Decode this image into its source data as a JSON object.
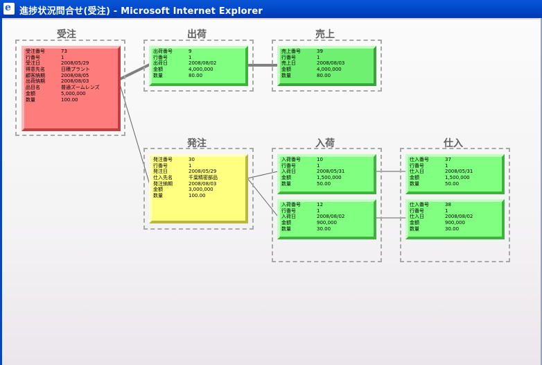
{
  "window": {
    "title": "進捗状況問合せ(受注) - Microsoft Internet Explorer",
    "icon": "ie-page-icon"
  },
  "groups": {
    "juchu": "受注",
    "shukka": "出荷",
    "uriage": "売上",
    "hacchu": "発注",
    "nyuka": "入荷",
    "shiire": "仕入"
  },
  "cards": {
    "juchu": [
      {
        "k": "受注番号",
        "v": "73"
      },
      {
        "k": "行番号",
        "v": "1"
      },
      {
        "k": "受注日",
        "v": "2008/05/29"
      },
      {
        "k": "得意先名",
        "v": "日積プラント"
      },
      {
        "k": "顧客納期",
        "v": "2008/08/05"
      },
      {
        "k": "出荷納期",
        "v": "2008/08/03"
      },
      {
        "k": "品目名",
        "v": "普通ズームレンズ"
      },
      {
        "k": "金額",
        "v": "5,000,000"
      },
      {
        "k": "数量",
        "v": "100.00"
      }
    ],
    "shukka": [
      {
        "k": "出荷番号",
        "v": "9"
      },
      {
        "k": "行番号",
        "v": "1"
      },
      {
        "k": "出荷日",
        "v": "2008/08/02"
      },
      {
        "k": "金額",
        "v": "4,000,000"
      },
      {
        "k": "数量",
        "v": "80.00"
      }
    ],
    "uriage": [
      {
        "k": "売上番号",
        "v": "39"
      },
      {
        "k": "行番号",
        "v": "1"
      },
      {
        "k": "売上日",
        "v": "2008/08/03"
      },
      {
        "k": "金額",
        "v": "4,000,000"
      },
      {
        "k": "数量",
        "v": "80.00"
      }
    ],
    "hacchu": [
      {
        "k": "発注番号",
        "v": "30"
      },
      {
        "k": "行番号",
        "v": "1"
      },
      {
        "k": "発注日",
        "v": "2008/05/29"
      },
      {
        "k": "仕入先名",
        "v": "千葉精密部品"
      },
      {
        "k": "発注納期",
        "v": "2008/08/03"
      },
      {
        "k": "金額",
        "v": "3,000,000"
      },
      {
        "k": "数量",
        "v": "100.00"
      }
    ],
    "nyuka1": [
      {
        "k": "入荷番号",
        "v": "10"
      },
      {
        "k": "行番号",
        "v": "1"
      },
      {
        "k": "入荷日",
        "v": "2008/05/31"
      },
      {
        "k": "金額",
        "v": "1,500,000"
      },
      {
        "k": "数量",
        "v": "50.00"
      }
    ],
    "nyuka2": [
      {
        "k": "入荷番号",
        "v": "12"
      },
      {
        "k": "行番号",
        "v": "1"
      },
      {
        "k": "入荷日",
        "v": "2008/08/02"
      },
      {
        "k": "金額",
        "v": "900,000"
      },
      {
        "k": "数量",
        "v": "30.00"
      }
    ],
    "shiire1": [
      {
        "k": "仕入番号",
        "v": "37"
      },
      {
        "k": "行番号",
        "v": "1"
      },
      {
        "k": "仕入日",
        "v": "2008/05/31"
      },
      {
        "k": "金額",
        "v": "1,500,000"
      },
      {
        "k": "数量",
        "v": "50.00"
      }
    ],
    "shiire2": [
      {
        "k": "仕入番号",
        "v": "38"
      },
      {
        "k": "行番号",
        "v": "1"
      },
      {
        "k": "仕入日",
        "v": "2008/08/02"
      },
      {
        "k": "金額",
        "v": "900,000"
      },
      {
        "k": "数量",
        "v": "30.00"
      }
    ]
  }
}
